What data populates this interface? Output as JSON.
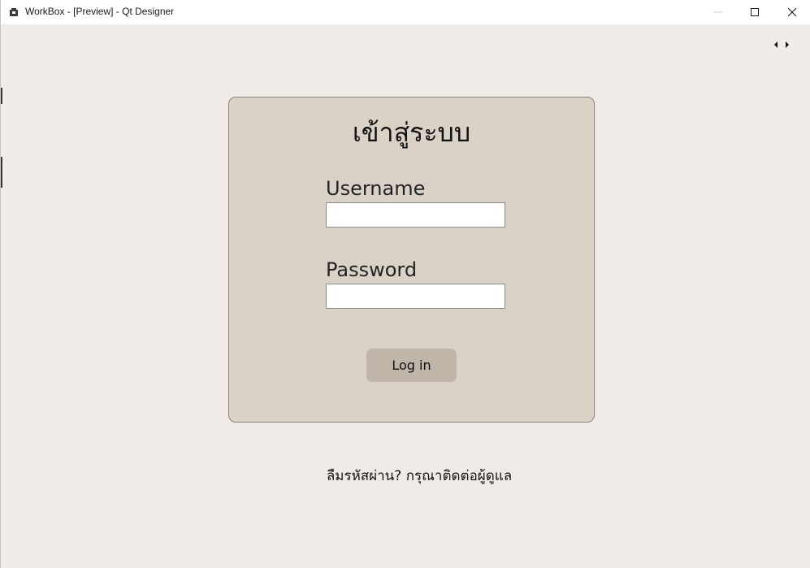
{
  "window": {
    "title": "WorkBox - [Preview] - Qt Designer",
    "icons": {
      "app": "qt-designer-icon",
      "minimize": "minimize-icon",
      "maximize": "maximize-icon",
      "close": "close-icon",
      "scroll_left": "arrow-left-icon",
      "scroll_right": "arrow-right-icon"
    }
  },
  "login": {
    "title": "เข้าสู่ระบบ",
    "username_label": "Username",
    "username_value": "",
    "password_label": "Password",
    "password_value": "",
    "login_button_label": "Log in"
  },
  "footer": {
    "forgot_text": "ลืมรหัสผ่าน? กรุณาติดต่อผู้ดูแล"
  },
  "colors": {
    "background": "#f0ebe6",
    "card_background": "#dad2c6",
    "card_border": "#8c857c",
    "button_background": "#bfb5a8"
  }
}
